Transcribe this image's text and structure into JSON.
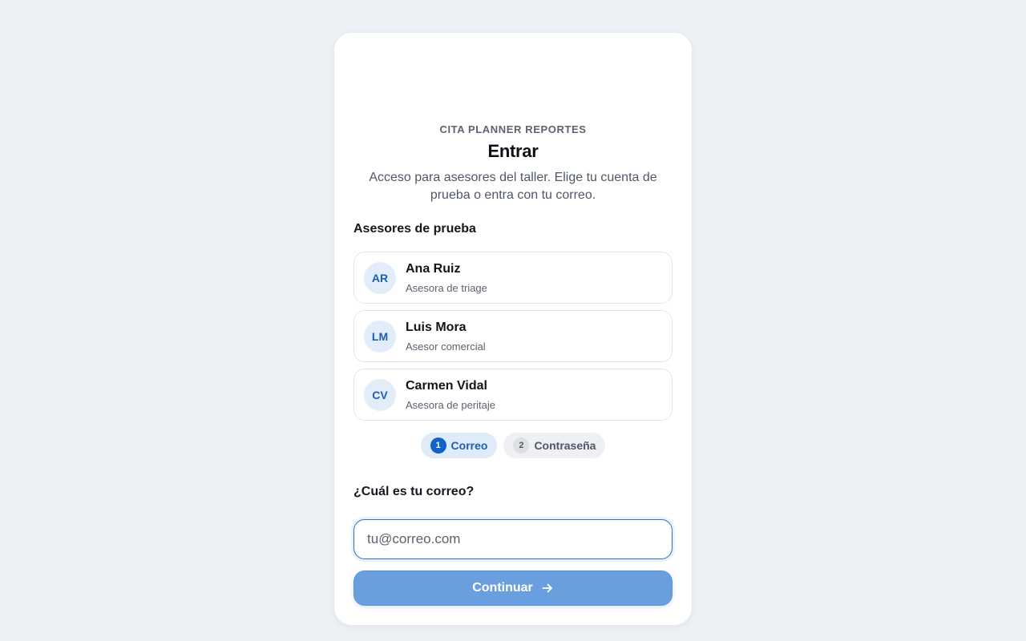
{
  "brand": "CITA PLANNER REPORTES",
  "title": "Entrar",
  "subtitle": "Acceso para asesores del taller. Elige tu cuenta de prueba o entra con tu correo.",
  "test_users_label": "Asesores de prueba",
  "users": [
    {
      "initials": "AR",
      "name": "Ana Ruiz",
      "role": "Asesora de triage"
    },
    {
      "initials": "LM",
      "name": "Luis Mora",
      "role": "Asesor comercial"
    },
    {
      "initials": "CV",
      "name": "Carmen Vidal",
      "role": "Asesora de peritaje"
    }
  ],
  "steps": [
    {
      "number": "1",
      "label": "Correo",
      "active": true
    },
    {
      "number": "2",
      "label": "Contraseña",
      "active": false
    }
  ],
  "email_question": "¿Cuál es tu correo?",
  "email_input": {
    "value": "",
    "placeholder": "tu@correo.com"
  },
  "continue_button": {
    "label": "Continuar",
    "icon": "arrow-right-icon"
  },
  "colors": {
    "background": "#edf1f6",
    "accent": "#1262c9",
    "button": "#6a9fdf",
    "avatar_bg": "#e3edf9"
  }
}
